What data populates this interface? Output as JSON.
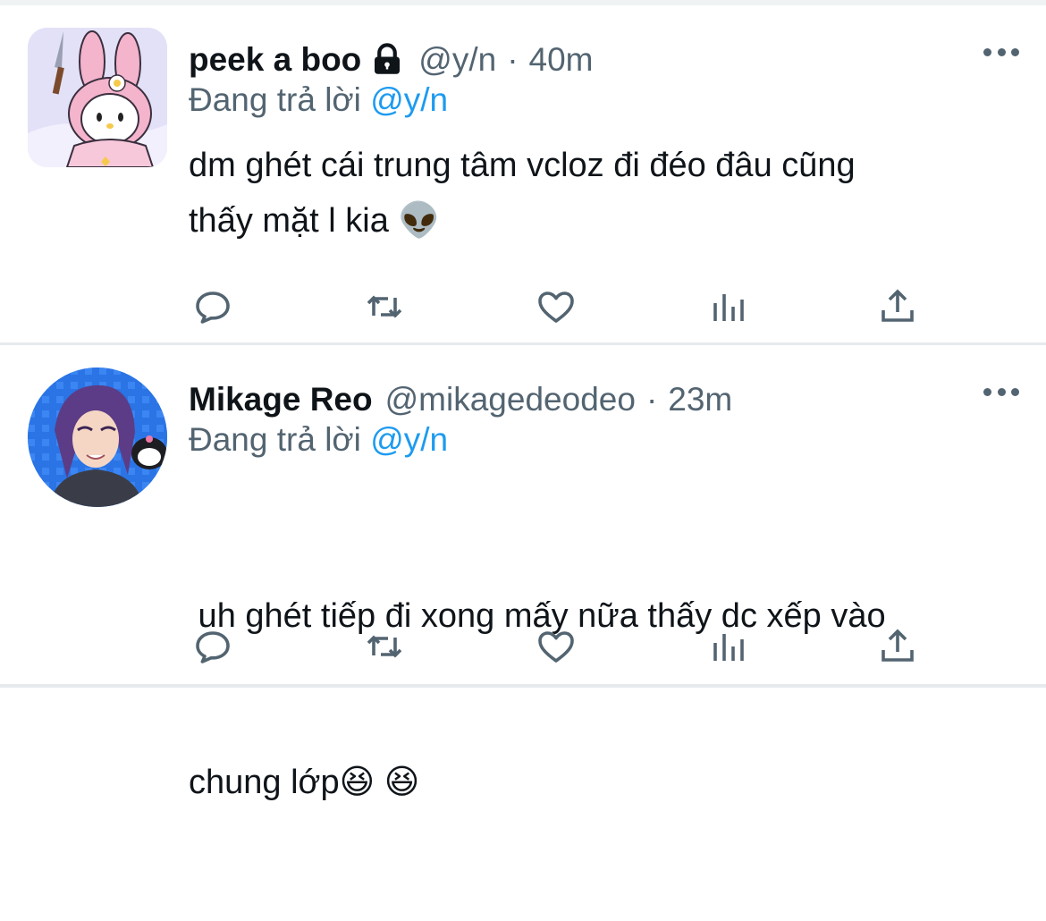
{
  "tweets": [
    {
      "name": "peek a boo",
      "handle": "@y/n",
      "separator": "·",
      "time": "40m",
      "reply_prefix": "Đang trả lời",
      "reply_to": "@y/n",
      "text_line1": "dm ghét cái trung tâm vcloz đi đéo đâu cũng",
      "text_line2": "thấy mặt l kia 👽",
      "locked": true
    },
    {
      "name": "Mikage Reo",
      "handle": "@mikagedeodeo",
      "separator": "·",
      "time": "23m",
      "reply_prefix": "Đang trả lời",
      "reply_to": "@y/n",
      "text_line1": " uh ghét tiếp đi xong mấy nữa thấy dc xếp vào",
      "text_line2": "chung lớp😆 😆",
      "locked": false
    }
  ],
  "icons": {
    "reply": "reply-icon",
    "retweet": "retweet-icon",
    "like": "like-icon",
    "stats": "stats-icon",
    "share": "share-icon",
    "more": "more-icon",
    "lock": "lock-icon"
  },
  "colors": {
    "text": "#0f1419",
    "secondary": "#536471",
    "link": "#1d9bf0",
    "divider": "#e6eaed"
  }
}
